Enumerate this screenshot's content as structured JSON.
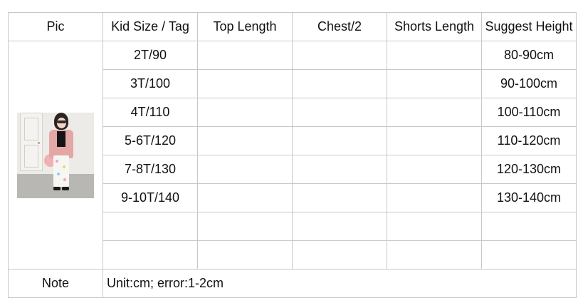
{
  "headers": [
    "Pic",
    "Kid Size / Tag",
    "Top Length",
    "Chest/2",
    "Shorts Length",
    "Suggest Height"
  ],
  "rows": [
    {
      "size": "2T/90",
      "top_length": "",
      "chest": "",
      "shorts_length": "",
      "height": "80-90cm"
    },
    {
      "size": "3T/100",
      "top_length": "",
      "chest": "",
      "shorts_length": "",
      "height": "90-100cm"
    },
    {
      "size": "4T/110",
      "top_length": "",
      "chest": "",
      "shorts_length": "",
      "height": "100-110cm"
    },
    {
      "size": "5-6T/120",
      "top_length": "",
      "chest": "",
      "shorts_length": "",
      "height": "110-120cm"
    },
    {
      "size": "7-8T/130",
      "top_length": "",
      "chest": "",
      "shorts_length": "",
      "height": "120-130cm"
    },
    {
      "size": "9-10T/140",
      "top_length": "",
      "chest": "",
      "shorts_length": "",
      "height": "130-140cm"
    },
    {
      "size": "",
      "top_length": "",
      "chest": "",
      "shorts_length": "",
      "height": ""
    },
    {
      "size": "",
      "top_length": "",
      "chest": "",
      "shorts_length": "",
      "height": ""
    }
  ],
  "note": {
    "label": "Note",
    "text": "Unit:cm; error:1-2cm"
  },
  "photo": {
    "subject": "girl-in-pink-cardigan-photo",
    "colors": {
      "cardigan": "#e3a7a6",
      "top": "#141414",
      "pants": "#f6f6f4",
      "wall": "#ecebe8"
    }
  },
  "colors": {
    "border": "#c8c8c8",
    "text": "#111111",
    "background": "#ffffff"
  }
}
